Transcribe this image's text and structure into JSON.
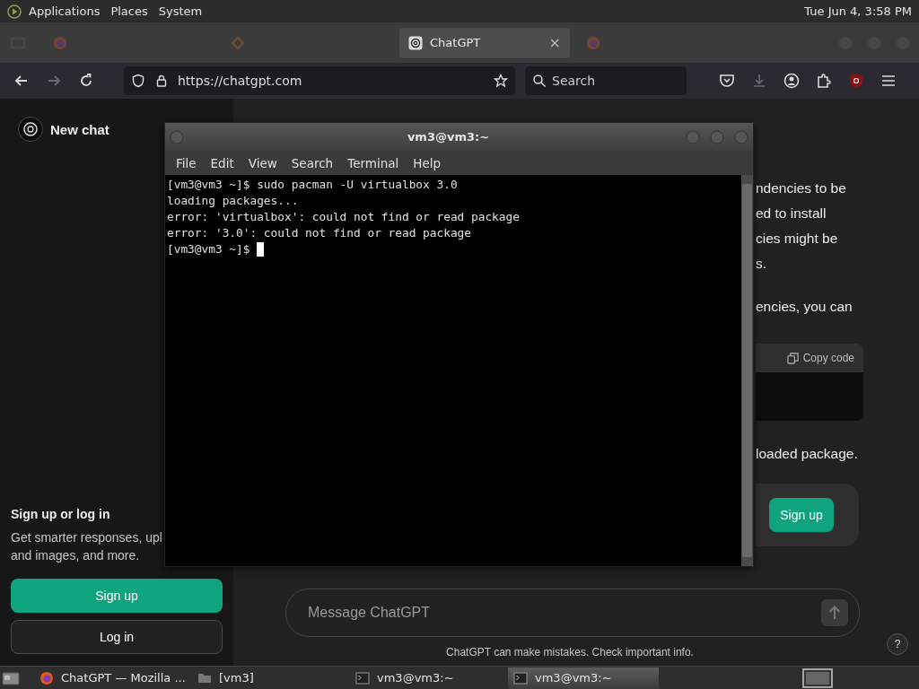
{
  "top_panel": {
    "menus": [
      "Applications",
      "Places",
      "System"
    ],
    "clock": "Tue Jun  4, 3:58 PM"
  },
  "browser": {
    "tabs": [
      {
        "kind": "firefox",
        "selected": false
      },
      {
        "kind": "code",
        "selected": false
      },
      {
        "kind": "chatgpt",
        "label": "ChatGPT",
        "close": "×",
        "selected": true
      },
      {
        "kind": "firefox",
        "selected": false
      }
    ],
    "forward_disabled": true,
    "url": "https://chatgpt.com",
    "search": {
      "placeholder": "Search"
    }
  },
  "sidebar": {
    "new_chat": "New chat",
    "signup_title": "Sign up or log in",
    "signup_text": [
      "Get smarter responses, upl",
      "and images, and more."
    ],
    "buttons": [
      {
        "label": "Sign up",
        "kind": "primary"
      },
      {
        "label": "Log in",
        "kind": "secondary"
      }
    ]
  },
  "chat": {
    "paragraphs": [
      [
        "ndencies to be",
        "ed to install",
        "cies might be",
        "s."
      ],
      [
        "encies, you can"
      ]
    ],
    "code_block": {
      "copy": "Copy code"
    },
    "after_code": "loaded package.",
    "signup_button": "Sign up",
    "message": {
      "placeholder": "Message ChatGPT"
    },
    "disclaimer": "ChatGPT can make mistakes. Check important info.",
    "help": "?"
  },
  "terminal": {
    "title": "vm3@vm3:~",
    "menu": [
      "File",
      "Edit",
      "View",
      "Search",
      "Terminal",
      "Help"
    ],
    "lines": [
      "[vm3@vm3 ~]$ sudo pacman -U virtualbox 3.0",
      "loading packages...",
      "error: 'virtualbox': could not find or read package",
      "error: '3.0': could not find or read package"
    ],
    "prompt": "[vm3@vm3 ~]$"
  },
  "taskbar": {
    "items": [
      {
        "kind": "firefox",
        "label": "ChatGPT — Mozilla ...",
        "selected": false
      },
      {
        "kind": "folder",
        "label": "[vm3]",
        "selected": false
      },
      {
        "kind": "terminal",
        "label": "vm3@vm3:~",
        "selected": false
      },
      {
        "kind": "terminal",
        "label": "vm3@vm3:~",
        "selected": true
      }
    ]
  }
}
